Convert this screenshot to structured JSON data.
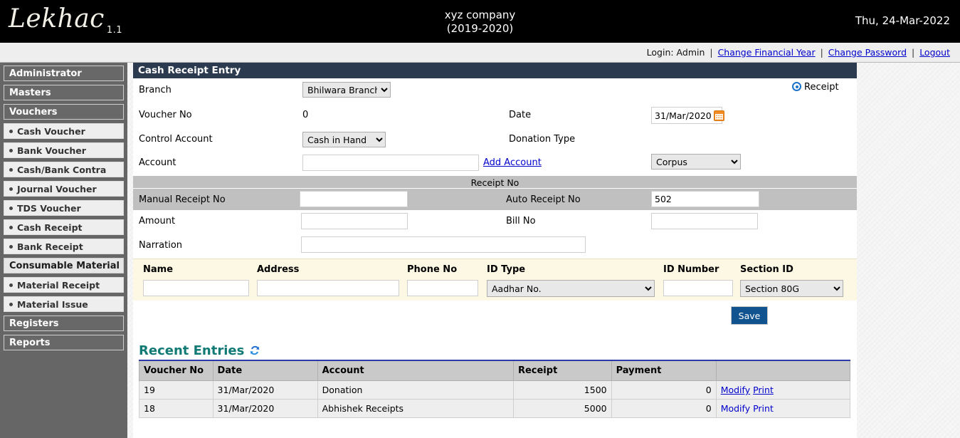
{
  "header": {
    "logo_text": "Lekhac",
    "logo_version": "1.1",
    "company_name": "xyz company",
    "financial_year": "(2019-2020)",
    "date": "Thu, 24-Mar-2022"
  },
  "loginbar": {
    "login_label": "Login: Admin",
    "change_financial_year": "Change Financial Year",
    "change_password": "Change Password",
    "logout": "Logout",
    "separator": "|"
  },
  "sidebar": {
    "items": [
      {
        "label": "Administrator",
        "type": "head"
      },
      {
        "label": "Masters",
        "type": "head"
      },
      {
        "label": "Vouchers",
        "type": "head"
      },
      {
        "label": "Cash Voucher",
        "type": "item"
      },
      {
        "label": "Bank Voucher",
        "type": "item"
      },
      {
        "label": "Cash/Bank Contra",
        "type": "item"
      },
      {
        "label": "Journal Voucher",
        "type": "item"
      },
      {
        "label": "TDS Voucher",
        "type": "item"
      },
      {
        "label": "Cash Receipt",
        "type": "item"
      },
      {
        "label": "Bank Receipt",
        "type": "item"
      },
      {
        "label": "Consumable Material",
        "type": "sub"
      },
      {
        "label": "Material Receipt",
        "type": "item"
      },
      {
        "label": "Material Issue",
        "type": "item"
      },
      {
        "label": "Registers",
        "type": "head"
      },
      {
        "label": "Reports",
        "type": "head"
      }
    ]
  },
  "panel": {
    "title": "Cash Receipt Entry",
    "branch_label": "Branch",
    "branch_value": "Bhilwara Branch",
    "voucher_no_label": "Voucher No",
    "voucher_no_value": "0",
    "control_account_label": "Control Account",
    "control_account_value": "Cash in Hand",
    "account_label": "Account",
    "account_value": "",
    "add_account_link": "Add Account",
    "receipt_radio_label": "Receipt",
    "date_label": "Date",
    "date_value": "31/Mar/2020",
    "donation_type_label": "Donation Type",
    "donation_type_value": "Corpus",
    "receipt_no_section_title": "Receipt No",
    "manual_receipt_no_label": "Manual Receipt No",
    "manual_receipt_no_value": "",
    "auto_receipt_no_label": "Auto Receipt No",
    "auto_receipt_no_value": "502",
    "amount_label": "Amount",
    "amount_value": "",
    "bill_no_label": "Bill No",
    "bill_no_value": "",
    "narration_label": "Narration",
    "narration_value": "",
    "save_label": "Save"
  },
  "donor": {
    "name_label": "Name",
    "name_value": "",
    "address_label": "Address",
    "address_value": "",
    "phone_label": "Phone No",
    "phone_value": "",
    "id_type_label": "ID Type",
    "id_type_value": "Aadhar No.",
    "id_number_label": "ID Number",
    "id_number_value": "",
    "section_id_label": "Section ID",
    "section_id_value": "Section 80G"
  },
  "recent": {
    "title": "Recent Entries",
    "columns": [
      "Voucher No",
      "Date",
      "Account",
      "Receipt",
      "Payment",
      ""
    ],
    "rows": [
      {
        "voucher_no": "19",
        "date": "31/Mar/2020",
        "account": "Donation",
        "receipt": "1500",
        "payment": "0",
        "modify": "Modify",
        "print": "Print"
      },
      {
        "voucher_no": "18",
        "date": "31/Mar/2020",
        "account": "Abhishek Receipts",
        "receipt": "5000",
        "payment": "0",
        "modify": "Modify",
        "print": "Print"
      }
    ]
  },
  "colors": {
    "panel_header": "#2b3a4e",
    "save_button": "#10538f",
    "link": "#0000cc",
    "recent_title": "#127a74",
    "calendar_icon": "#f28b21",
    "donor_band": "#fdf8e3"
  }
}
